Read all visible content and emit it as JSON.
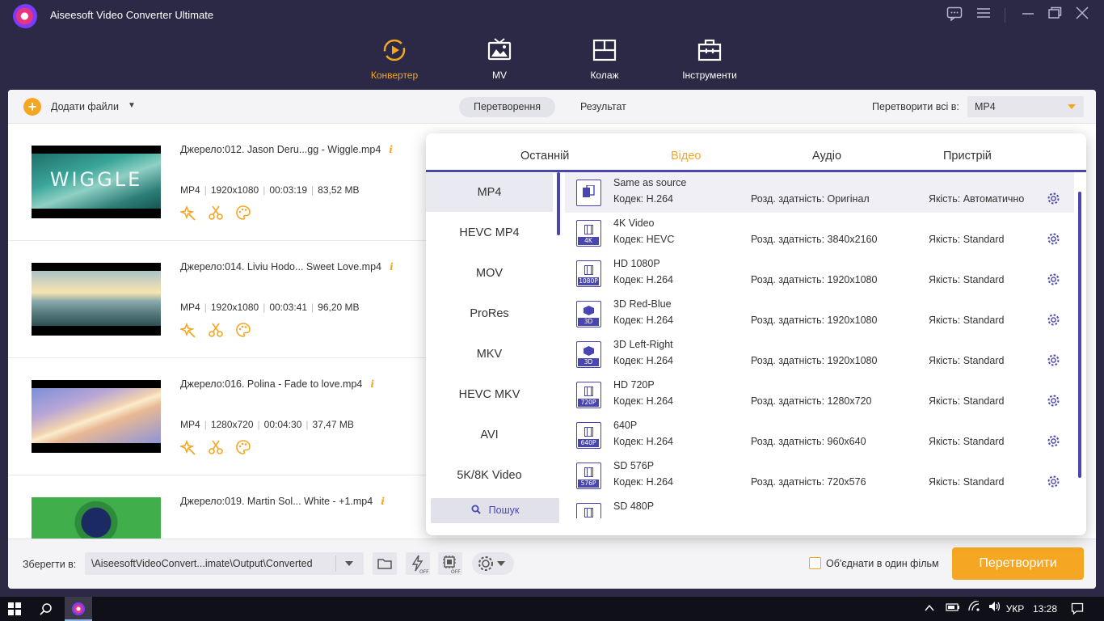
{
  "app": {
    "title": "Aiseesoft Video Converter Ultimate"
  },
  "nav": [
    {
      "label": "Конвертер",
      "active": true
    },
    {
      "label": "MV"
    },
    {
      "label": "Колаж"
    },
    {
      "label": "Інструменти"
    }
  ],
  "toolbar": {
    "add_files": "Додати файли",
    "tab_convert": "Перетворення",
    "tab_result": "Результат",
    "convert_all_label": "Перетворити всі в:",
    "convert_all_value": "MP4"
  },
  "files": [
    {
      "name": "Джерело:012. Jason Deru...gg - Wiggle.mp4",
      "format": "MP4",
      "resolution": "1920x1080",
      "duration": "00:03:19",
      "size": "83,52 MB",
      "thumb_text": "WIGGLE"
    },
    {
      "name": "Джерело:014. Liviu Hodo... Sweet Love.mp4",
      "format": "MP4",
      "resolution": "1920x1080",
      "duration": "00:03:41",
      "size": "96,20 MB"
    },
    {
      "name": "Джерело:016. Polina - Fade to love.mp4",
      "format": "MP4",
      "resolution": "1280x720",
      "duration": "00:04:30",
      "size": "37,47 MB"
    },
    {
      "name": "Джерело:019. Martin Sol... White - +1.mp4"
    }
  ],
  "format_panel": {
    "tabs": [
      "Останній",
      "Відео",
      "Аудіо",
      "Пристрій"
    ],
    "active_tab": "Відео",
    "categories": [
      "MP4",
      "HEVC MP4",
      "MOV",
      "ProRes",
      "MKV",
      "HEVC MKV",
      "AVI",
      "5K/8K Video"
    ],
    "active_category": "MP4",
    "search_label": "Пошук",
    "presets": [
      {
        "name": "Same as source",
        "codec": "Кодек: H.264",
        "res": "Розд. здатність: Оригінал",
        "quality": "Якість: Автоматично",
        "tag": ""
      },
      {
        "name": "4K Video",
        "codec": "Кодек: HEVC",
        "res": "Розд. здатність: 3840x2160",
        "quality": "Якість: Standard",
        "tag": "4K"
      },
      {
        "name": "HD 1080P",
        "codec": "Кодек: H.264",
        "res": "Розд. здатність: 1920x1080",
        "quality": "Якість: Standard",
        "tag": "1080P"
      },
      {
        "name": "3D Red-Blue",
        "codec": "Кодек: H.264",
        "res": "Розд. здатність: 1920x1080",
        "quality": "Якість: Standard",
        "tag": "3D"
      },
      {
        "name": "3D Left-Right",
        "codec": "Кодек: H.264",
        "res": "Розд. здатність: 1920x1080",
        "quality": "Якість: Standard",
        "tag": "3D"
      },
      {
        "name": "HD 720P",
        "codec": "Кодек: H.264",
        "res": "Розд. здатність: 1280x720",
        "quality": "Якість: Standard",
        "tag": "720P"
      },
      {
        "name": "640P",
        "codec": "Кодек: H.264",
        "res": "Розд. здатність: 960x640",
        "quality": "Якість: Standard",
        "tag": "640P"
      },
      {
        "name": "SD 576P",
        "codec": "Кодек: H.264",
        "res": "Розд. здатність: 720x576",
        "quality": "Якість: Standard",
        "tag": "576P"
      },
      {
        "name": "SD 480P",
        "codec": "",
        "res": "",
        "quality": "",
        "tag": ""
      }
    ]
  },
  "bottom": {
    "save_to_label": "Зберегти в:",
    "save_path": "\\AiseesoftVideoConvert...imate\\Output\\Converted",
    "merge_label": "Об'єднати в один фільм",
    "convert_button": "Перетворити"
  },
  "taskbar": {
    "lang": "УКР",
    "time": "13:28"
  },
  "colors": {
    "accent": "#f5a623",
    "primary": "#4a46b0",
    "header_bg": "#2b2946"
  }
}
